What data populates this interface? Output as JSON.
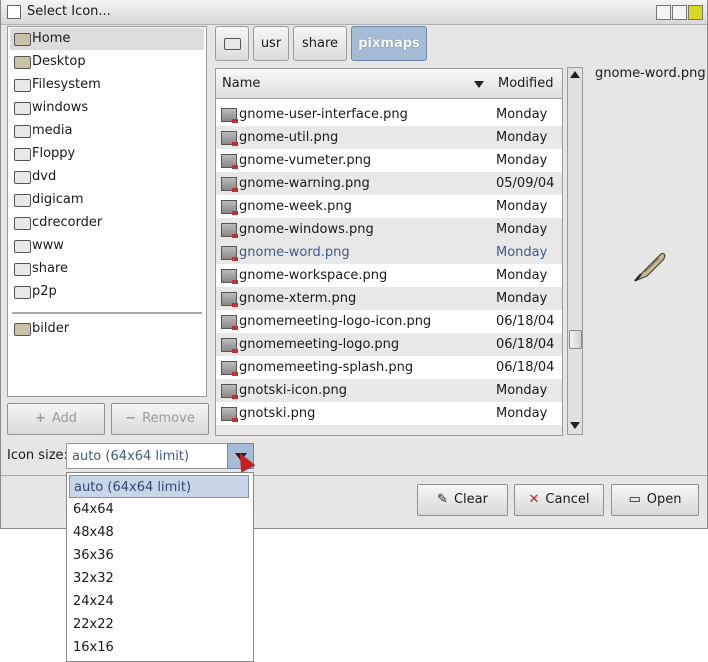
{
  "window": {
    "title": "Select Icon..."
  },
  "sidebar": {
    "items": [
      {
        "label": "Home",
        "icon": "home-icon"
      },
      {
        "label": "Desktop",
        "icon": "desktop-icon"
      },
      {
        "label": "Filesystem",
        "icon": "drive-icon"
      },
      {
        "label": "windows",
        "icon": "drive-icon"
      },
      {
        "label": "media",
        "icon": "drive-icon"
      },
      {
        "label": "Floppy",
        "icon": "drive-icon"
      },
      {
        "label": "dvd",
        "icon": "drive-icon"
      },
      {
        "label": "digicam",
        "icon": "drive-icon"
      },
      {
        "label": "cdrecorder",
        "icon": "drive-icon"
      },
      {
        "label": "www",
        "icon": "drive-icon"
      },
      {
        "label": "share",
        "icon": "drive-icon"
      },
      {
        "label": "p2p",
        "icon": "drive-icon"
      }
    ],
    "bookmarks": [
      {
        "label": "bilder",
        "icon": "folder-icon"
      }
    ],
    "add_label": "Add",
    "remove_label": "Remove"
  },
  "path": {
    "segments": [
      "usr",
      "share",
      "pixmaps"
    ]
  },
  "filelist": {
    "col_name": "Name",
    "col_modified": "Modified",
    "rows": [
      {
        "name": "gnome-user-interface.png",
        "modified": "Monday"
      },
      {
        "name": "gnome-util.png",
        "modified": "Monday"
      },
      {
        "name": "gnome-vumeter.png",
        "modified": "Monday"
      },
      {
        "name": "gnome-warning.png",
        "modified": "05/09/04"
      },
      {
        "name": "gnome-week.png",
        "modified": "Monday"
      },
      {
        "name": "gnome-windows.png",
        "modified": "Monday"
      },
      {
        "name": "gnome-word.png",
        "modified": "Monday"
      },
      {
        "name": "gnome-workspace.png",
        "modified": "Monday"
      },
      {
        "name": "gnome-xterm.png",
        "modified": "Monday"
      },
      {
        "name": "gnomemeeting-logo-icon.png",
        "modified": "06/18/04"
      },
      {
        "name": "gnomemeeting-logo.png",
        "modified": "06/18/04"
      },
      {
        "name": "gnomemeeting-splash.png",
        "modified": "06/18/04"
      },
      {
        "name": "gnotski-icon.png",
        "modified": "Monday"
      },
      {
        "name": "gnotski.png",
        "modified": "Monday"
      }
    ],
    "selected_index": 6
  },
  "preview": {
    "filename": "gnome-word.png",
    "icon": "quill-pen-icon"
  },
  "icon_size": {
    "label": "Icon size:",
    "value": "auto (64x64 limit)",
    "options": [
      "auto (64x64 limit)",
      "64x64",
      "48x48",
      "36x36",
      "32x32",
      "24x24",
      "22x22",
      "16x16"
    ]
  },
  "buttons": {
    "clear": "Clear",
    "cancel": "Cancel",
    "open": "Open"
  },
  "colors": {
    "accent": "#a6bbd6",
    "selection_text": "#3d5d85",
    "window_bg": "#e6e6e6"
  }
}
